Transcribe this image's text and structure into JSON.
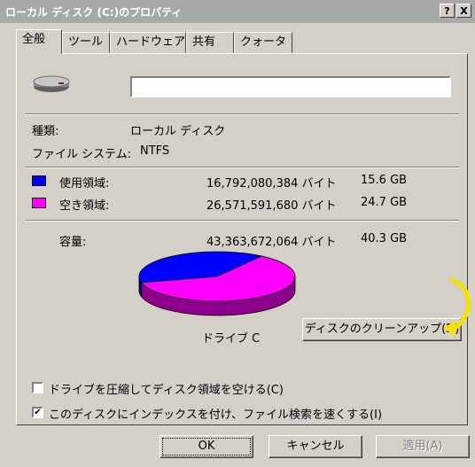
{
  "window": {
    "title": "ローカル ディスク (C:)のプロパティ",
    "help_button": "?",
    "close_button": "X"
  },
  "tabs": [
    {
      "label": "全般",
      "active": true
    },
    {
      "label": "ツール"
    },
    {
      "label": "ハードウェア"
    },
    {
      "label": "共有"
    },
    {
      "label": "クォータ"
    }
  ],
  "general": {
    "drive_icon": "hard-drive-icon",
    "name_value": "",
    "type_label": "種類:",
    "type_value": "ローカル ディスク",
    "fs_label": "ファイル システム:",
    "fs_value": "NTFS",
    "used": {
      "label": "使用領域:",
      "bytes": "16,792,080,384 バイト",
      "size": "15.6 GB",
      "color": "#0000ff"
    },
    "free": {
      "label": "空き領域:",
      "bytes": "26,571,591,680 バイト",
      "size": "24.7 GB",
      "color": "#ff00ff"
    },
    "capacity": {
      "label": "容量:",
      "bytes": "43,363,672,064 バイト",
      "size": "40.3 GB"
    },
    "drive_label": "ドライブ C",
    "cleanup_button": "ディスクのクリーンアップ(D)",
    "compress_checkbox": {
      "label": "ドライブを圧縮してディスク領域を空ける(C)",
      "checked": false
    },
    "index_checkbox": {
      "label": "このディスクにインデックスを付け、ファイル検索を速くする(I)",
      "checked": true
    }
  },
  "chart_data": {
    "type": "pie",
    "categories": [
      "使用領域",
      "空き領域"
    ],
    "values": [
      15.6,
      24.7
    ],
    "colors": [
      "#0000ff",
      "#ff00ff"
    ]
  },
  "buttons": {
    "ok": "OK",
    "cancel": "キャンセル",
    "apply": "適用(A)"
  },
  "annotation": {
    "color": "#f5e000",
    "icon": "curved-arrow-icon"
  }
}
